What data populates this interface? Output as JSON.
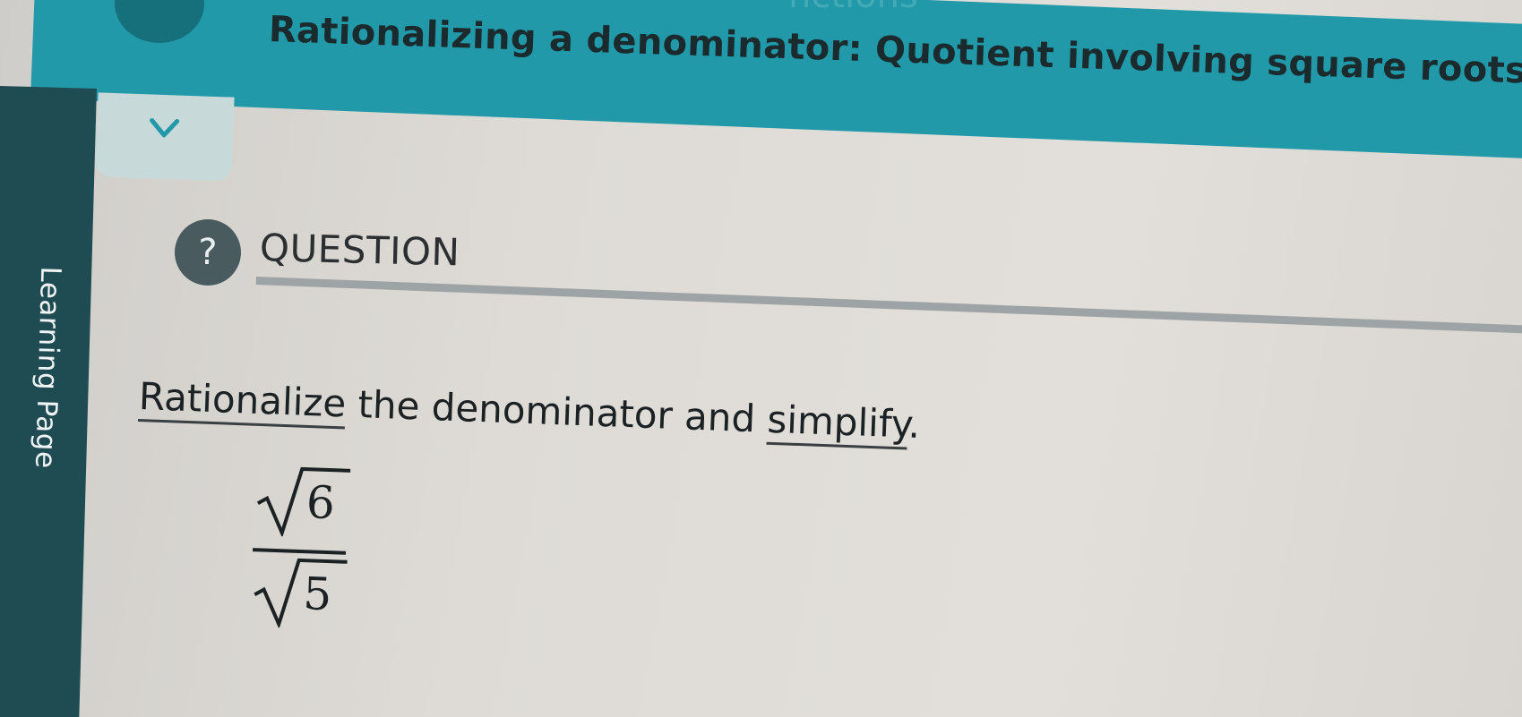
{
  "header": {
    "background_title_fragment": "nctions",
    "title": "Rationalizing a denominator: Quotient involving square roots",
    "menu_icon": "hamburger-menu-icon",
    "color": "#2199a8"
  },
  "sidebar": {
    "label": "Learning Page",
    "color": "#1f4c53"
  },
  "collapse": {
    "icon": "chevron-down-icon"
  },
  "question": {
    "icon_glyph": "?",
    "label": "QUESTION"
  },
  "prompt": {
    "word_1": "Rationalize",
    "middle": " the denominator and ",
    "word_2": "simplify",
    "end": "."
  },
  "expression": {
    "numerator_radicand": "6",
    "denominator_radicand": "5"
  }
}
